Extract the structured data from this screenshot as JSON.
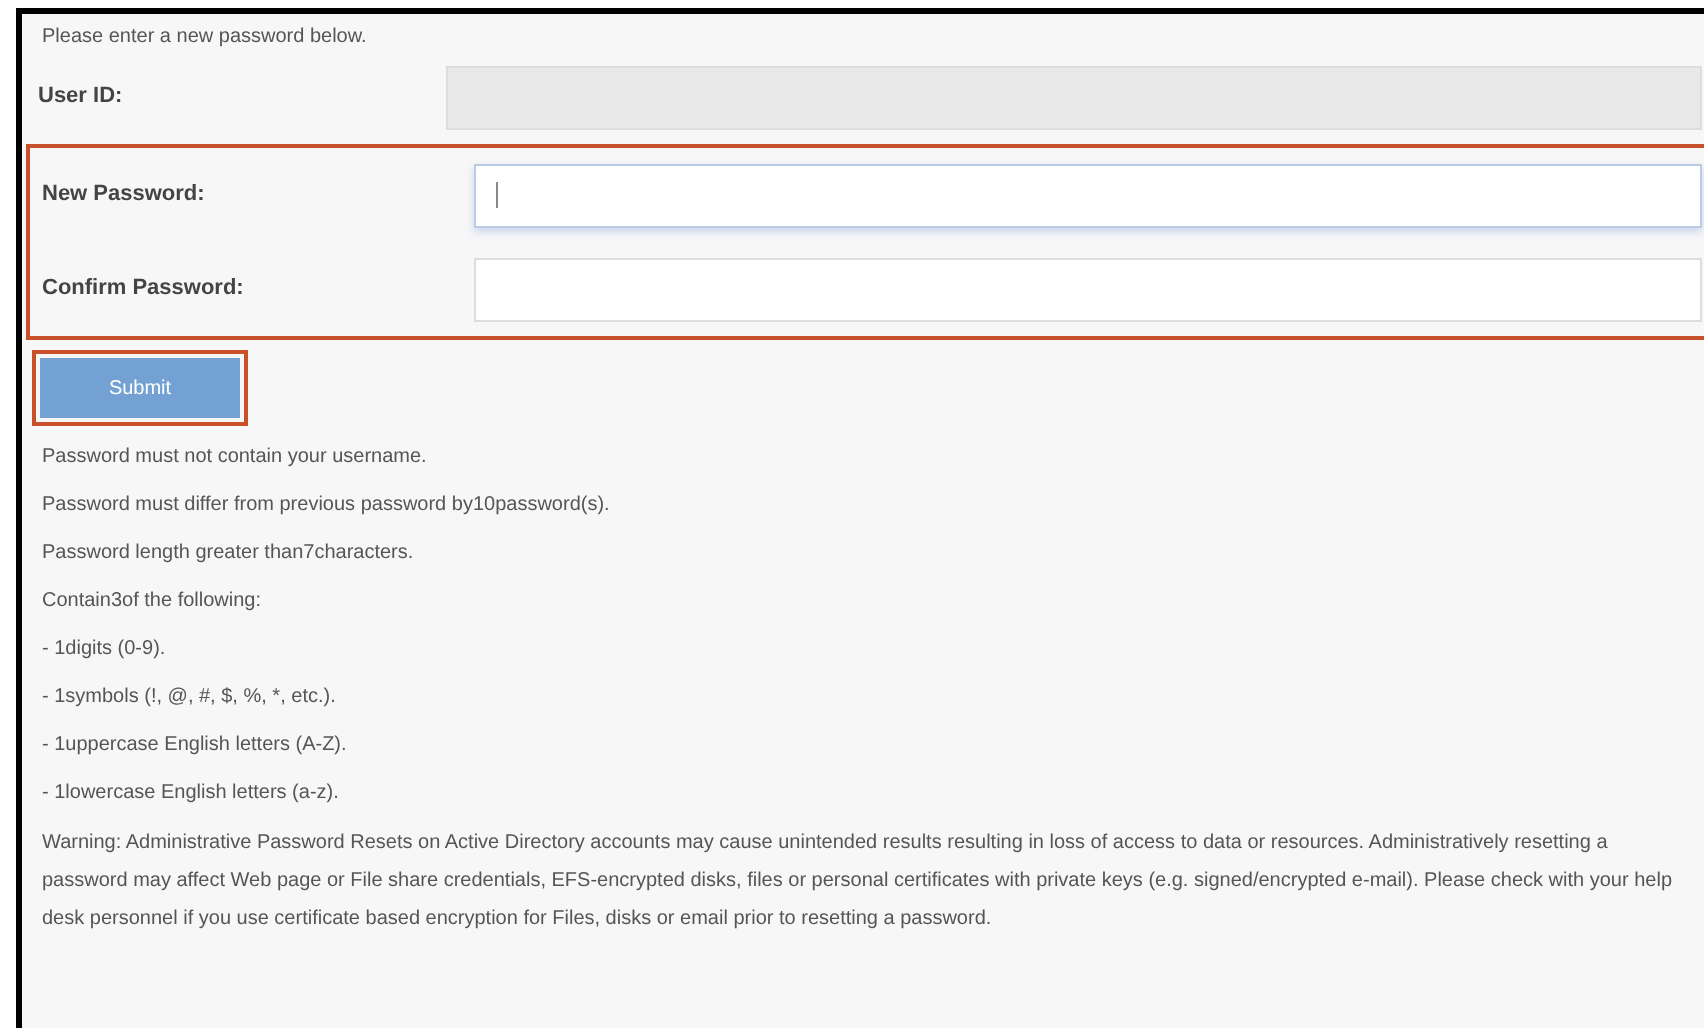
{
  "intro": "Please enter a new password below.",
  "fields": [
    {
      "label": "User ID:",
      "disabled": true,
      "focused": false,
      "highlighted": false
    },
    {
      "label": "New Password:",
      "disabled": false,
      "focused": true,
      "highlighted": true
    },
    {
      "label": "Confirm Password:",
      "disabled": false,
      "focused": false,
      "highlighted": true
    }
  ],
  "submit": {
    "label": "Submit",
    "highlighted": true
  },
  "rules": [
    "Password must not contain your username.",
    "Password must differ from previous password by10password(s).",
    "Password length greater than7characters.",
    "Contain3of the following:",
    "- 1digits (0-9).",
    "- 1symbols (!, @, #, $, %, *, etc.).",
    "- 1uppercase English letters (A-Z).",
    "- 1lowercase English letters (a-z)."
  ],
  "warning": "Warning: Administrative Password Resets on Active Directory accounts may cause unintended results resulting in loss of access to data or resources. Administratively resetting a password may affect Web page or File share credentials, EFS-encrypted disks, files or personal certificates with private keys (e.g. signed/encrypted e-mail). Please check with your help desk personnel if you use certificate based encryption for Files, disks or email prior to resetting a password."
}
